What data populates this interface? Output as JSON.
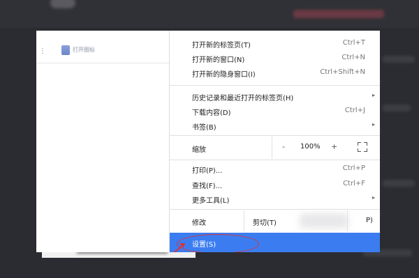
{
  "bookmarks_bar": {
    "apps_icon": "apps-grid-icon",
    "bookmark_label": "打开图标"
  },
  "menu": {
    "items_top": [
      {
        "label": "打开新的标签页(T)",
        "shortcut": "Ctrl+T"
      },
      {
        "label": "打开新的窗口(N)",
        "shortcut": "Ctrl+N"
      },
      {
        "label": "打开新的隐身窗口(I)",
        "shortcut": "Ctrl+Shift+N"
      }
    ],
    "history": {
      "label": "历史记录和最近打开的标签页(H)",
      "arrow": "▸"
    },
    "downloads": {
      "label": "下载内容(D)",
      "shortcut": "Ctrl+J"
    },
    "bookmarks": {
      "label": "书签(B)",
      "arrow": "▸"
    },
    "zoom": {
      "label": "缩放",
      "minus": "-",
      "value": "100%",
      "plus": "+"
    },
    "print": {
      "label": "打印(P)...",
      "shortcut": "Ctrl+P"
    },
    "find": {
      "label": "查找(F)...",
      "shortcut": "Ctrl+F"
    },
    "more_tools": {
      "label": "更多工具(L)",
      "arrow": "▸"
    },
    "edit": {
      "label": "修改",
      "cut": "剪切(T)",
      "paste_tail": "P)"
    },
    "settings": {
      "label": "设置(S)"
    }
  },
  "colors": {
    "highlight": "#3b7df1",
    "annotation": "#d8343c"
  }
}
